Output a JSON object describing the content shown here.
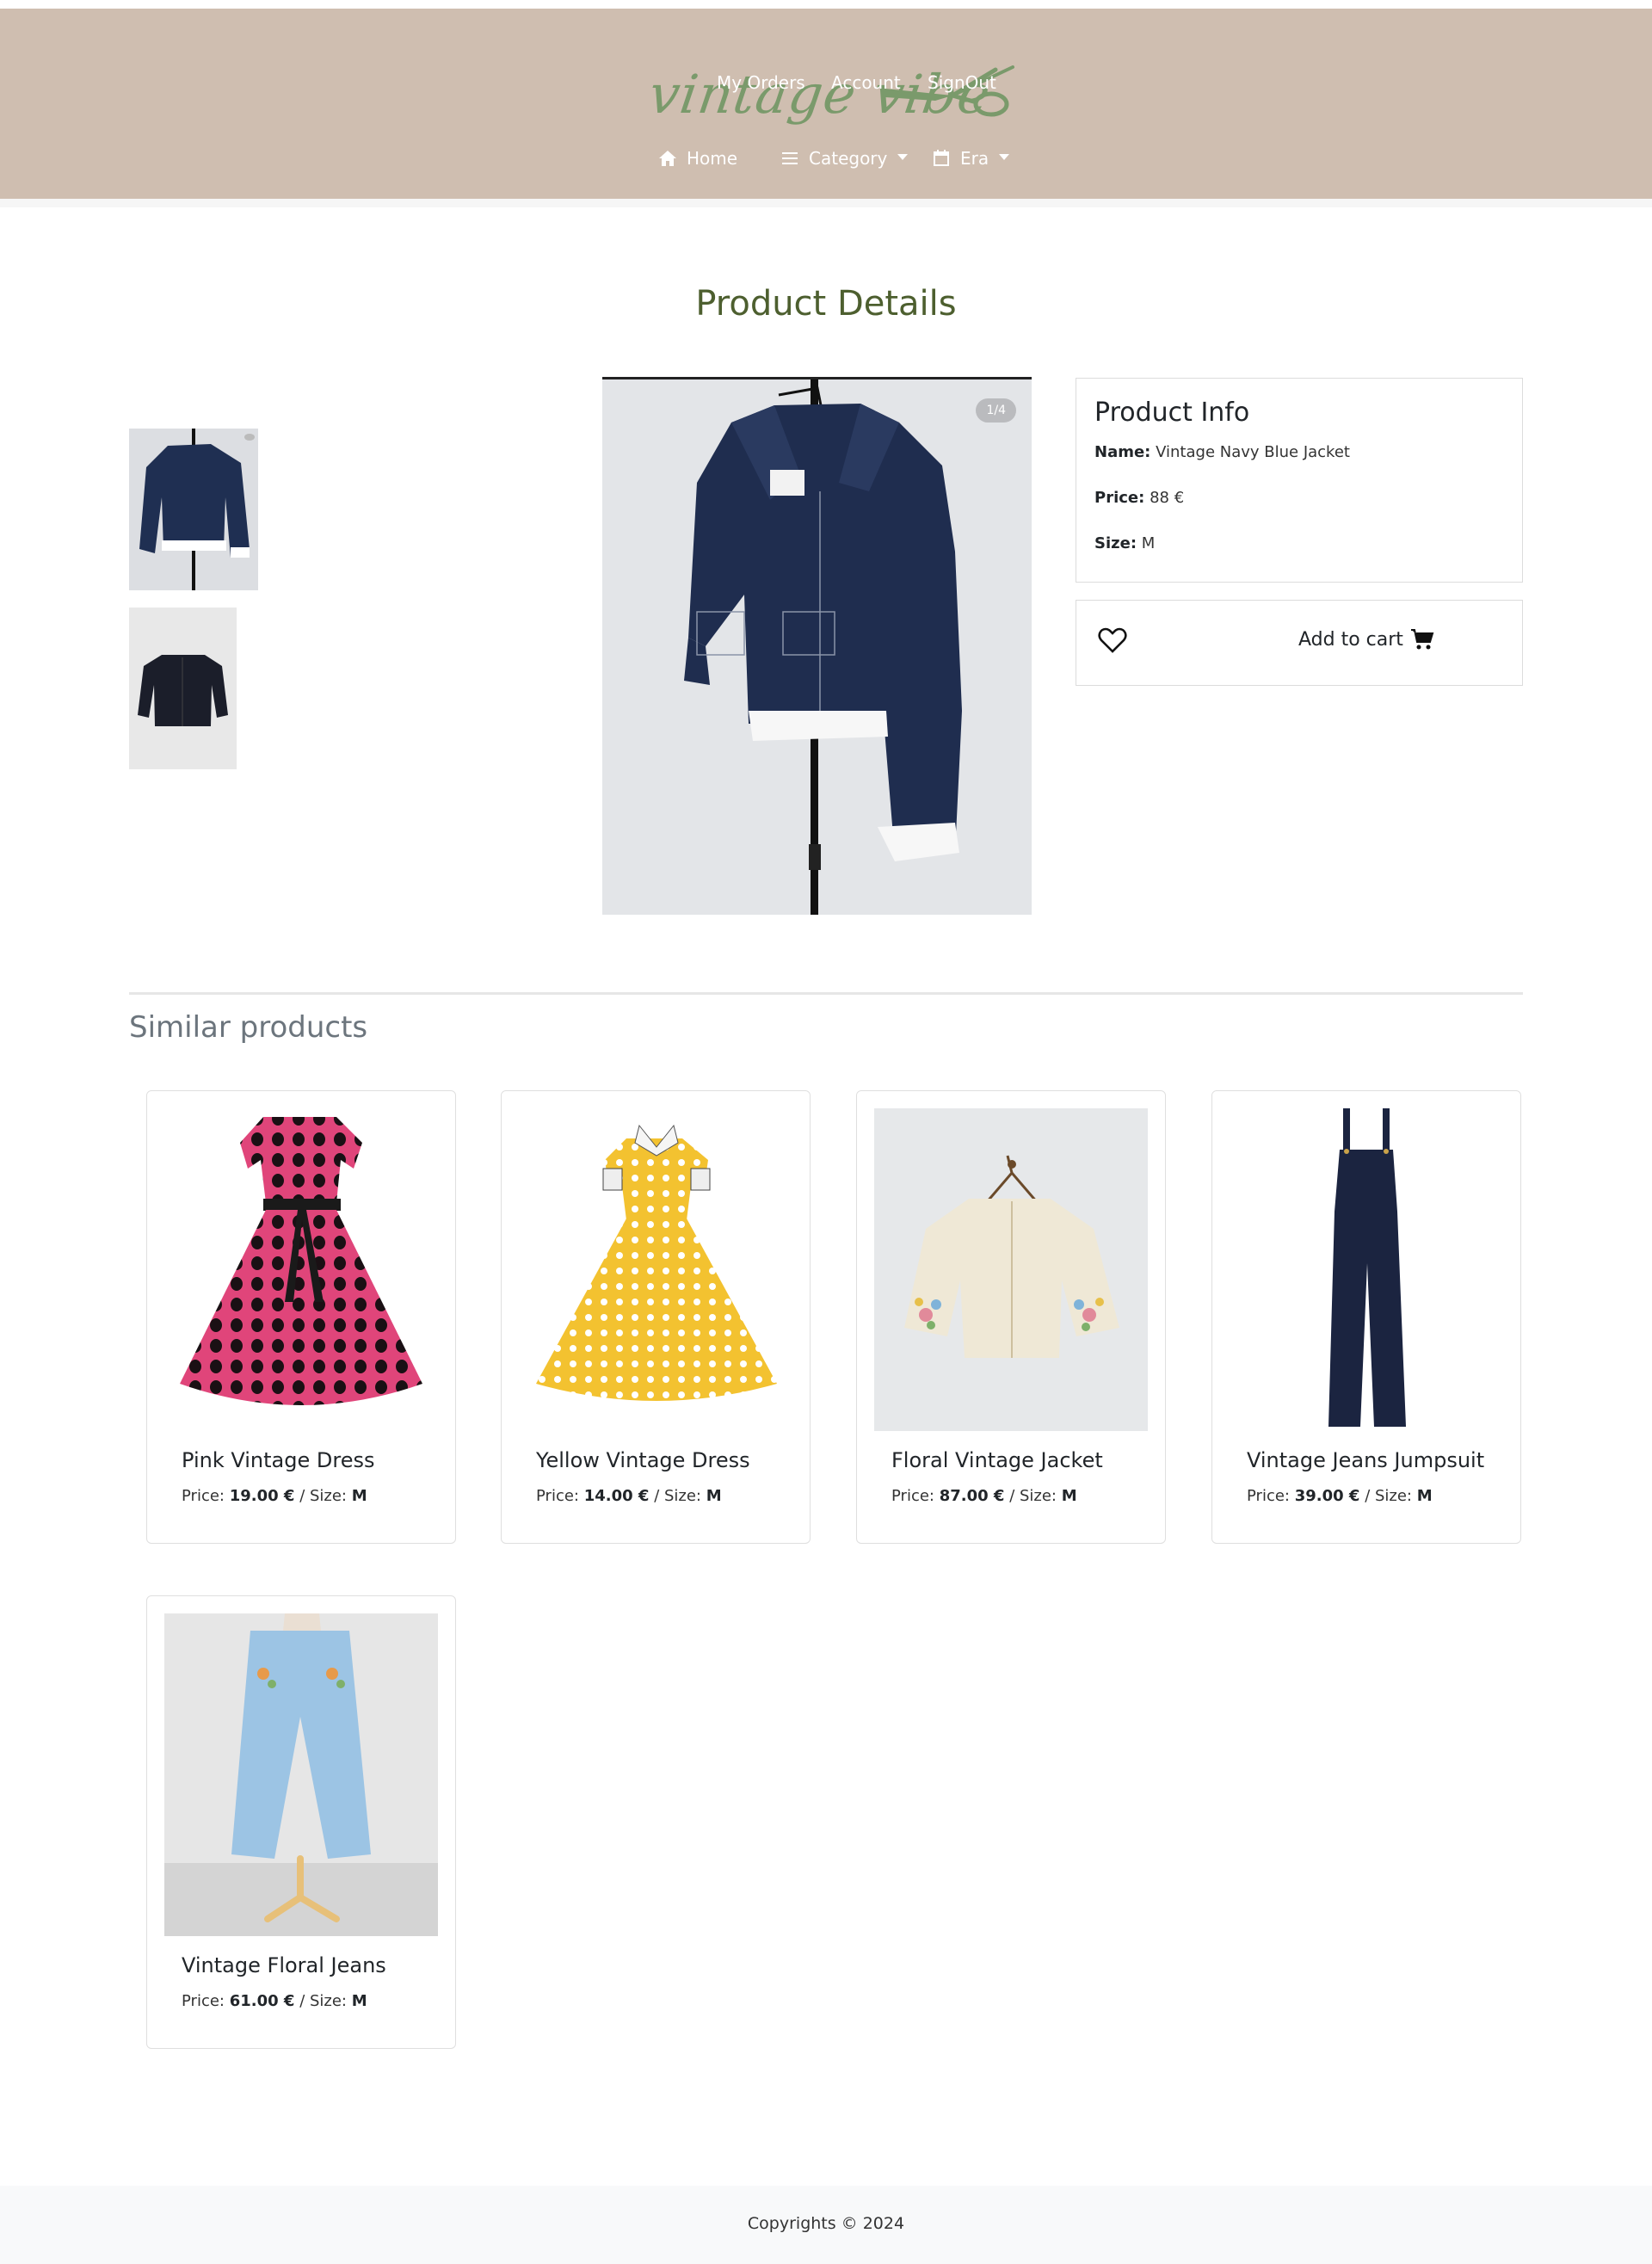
{
  "header": {
    "logo_text": "vintage vibe",
    "top_links": [
      "My Orders",
      "Account",
      "SignOut"
    ],
    "nav": {
      "home": "Home",
      "category": "Category",
      "era": "Era"
    }
  },
  "page_title": "Product Details",
  "gallery": {
    "counter": "1/4"
  },
  "product_info": {
    "title": "Product Info",
    "name_label": "Name:",
    "name": "Vintage Navy Blue Jacket",
    "price_label": "Price:",
    "price": "88 €",
    "size_label": "Size:",
    "size": "M",
    "add_to_cart": "Add to cart"
  },
  "similar": {
    "title": "Similar products",
    "price_label": "Price:",
    "size_label": "/ Size:",
    "items": [
      {
        "name": "Pink Vintage Dress",
        "price": "19.00 €",
        "size": "M"
      },
      {
        "name": "Yellow Vintage Dress",
        "price": "14.00 €",
        "size": "M"
      },
      {
        "name": "Floral Vintage Jacket",
        "price": "87.00 €",
        "size": "M"
      },
      {
        "name": "Vintage Jeans Jumpsuit",
        "price": "39.00 €",
        "size": "M"
      },
      {
        "name": "Vintage Floral Jeans",
        "price": "61.00 €",
        "size": "M"
      }
    ]
  },
  "footer": {
    "text": "Copyrights © 2024"
  },
  "colors": {
    "header_bg": "#cfbeb0",
    "title_green": "#4d5f2f",
    "logo_green": "#7a9a6b"
  }
}
